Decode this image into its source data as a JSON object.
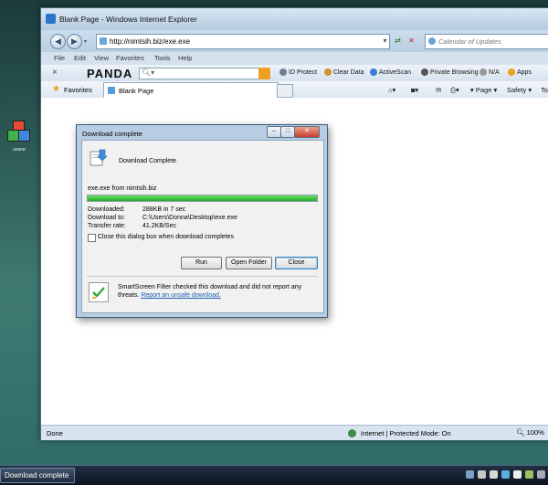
{
  "desktop": {
    "icon_label": "ozone"
  },
  "window": {
    "title": "Blank Page - Windows Internet Explorer"
  },
  "navbar": {
    "url": "http://nimtsih.biz/exe.exe",
    "search_placeholder": "Calendar of Updates"
  },
  "menu": [
    "File",
    "Edit",
    "View",
    "Favorites",
    "Tools",
    "Help"
  ],
  "toolbar": {
    "close_glyph": "×",
    "brand": "PANDA",
    "items": [
      {
        "label": "ID Protect",
        "color": "#6a7f96"
      },
      {
        "label": "Clear Data",
        "color": "#c9962a"
      },
      {
        "label": "ActiveScan",
        "color": "#3a7bd5"
      },
      {
        "label": "Private Browsing",
        "color": "#555555"
      },
      {
        "label": "N/A",
        "color": "#999999"
      },
      {
        "label": "Apps",
        "color": "#f0a020"
      }
    ]
  },
  "favorites": {
    "label": "Favorites",
    "tab_title": "Blank Page"
  },
  "command_bar": {
    "page": "Page",
    "safety": "Safety",
    "tools": "To"
  },
  "status": {
    "left": "Done",
    "zone": "Internet | Protected Mode: On",
    "zoom": "100%"
  },
  "dialog": {
    "title": "Download complete",
    "heading": "Download Complete",
    "source": "exe.exe from nimtsih.biz",
    "progress": 1.0,
    "rows": [
      {
        "label": "Downloaded:",
        "value": "288KB in 7 sec"
      },
      {
        "label": "Download to:",
        "value": "C:\\Users\\Donna\\Desktop\\exe.exe"
      },
      {
        "label": "Transfer rate:",
        "value": "41.2KB/Sec"
      }
    ],
    "checkbox_label": "Close this dialog box when download completes",
    "buttons": {
      "run": "Run",
      "open_folder": "Open Folder",
      "close": "Close"
    },
    "smartscreen_text": "SmartScreen Filter checked this download and did not report any threats.",
    "smartscreen_link": "Report an unsafe download."
  },
  "taskbar": {
    "active_item": "Download complete"
  }
}
